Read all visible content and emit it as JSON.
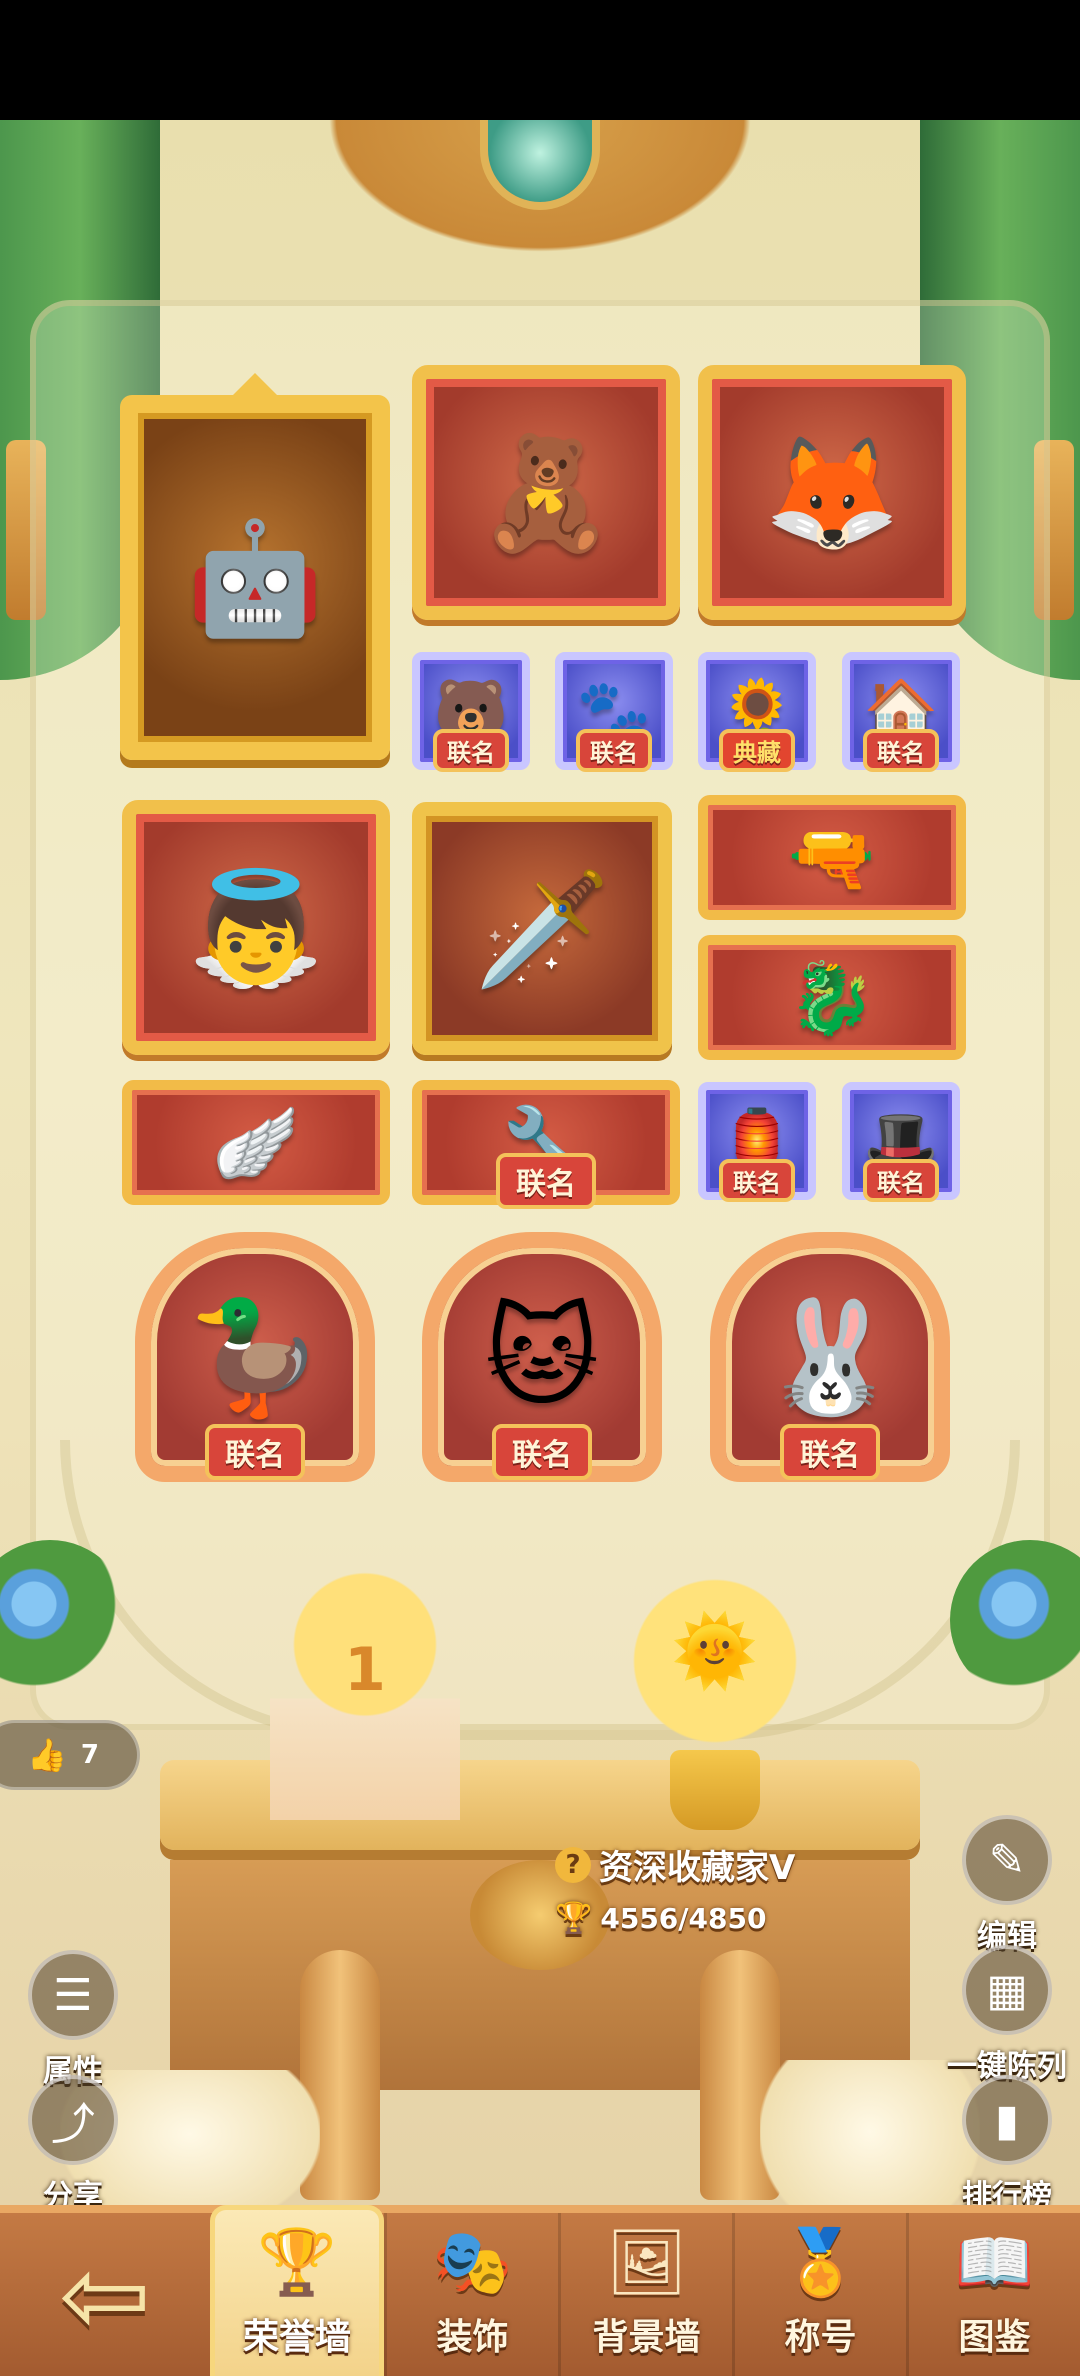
{
  "side_buttons": {
    "attributes": "属性",
    "share": "分享",
    "edit": "编辑",
    "arrange": "一键陈列",
    "ranking": "排行榜"
  },
  "likes": {
    "count": "7"
  },
  "collector": {
    "title": "资深收藏家V",
    "score": "4556/4850"
  },
  "trophy_cake_number": "1",
  "items": {
    "tag_collab": "联名",
    "tag_classic": "典藏"
  },
  "bottom_nav": {
    "honor_wall": "荣誉墙",
    "decoration": "装饰",
    "background_wall": "背景墙",
    "title": "称号",
    "codex": "图鉴"
  },
  "colors": {
    "frame_gold": "#f0c34a",
    "frame_red": "#a33b2c",
    "frame_blue": "#4b4fc8",
    "nav_bg": "#b06636"
  },
  "icons": {
    "like": "thumbs-up-icon",
    "question": "question-icon",
    "trophy": "trophy-icon",
    "back": "back-arrow-icon"
  }
}
